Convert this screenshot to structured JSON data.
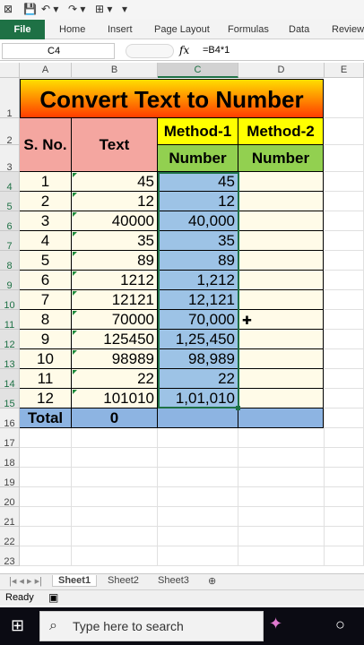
{
  "ribbon": {
    "file": "File",
    "tabs": [
      "Home",
      "Insert",
      "Page Layout",
      "Formulas",
      "Data",
      "Review"
    ]
  },
  "formula_bar": {
    "cell_ref": "C4",
    "fx": "fx",
    "formula": "=B4*1"
  },
  "columns": [
    "A",
    "B",
    "C",
    "D",
    "E"
  ],
  "rows": [
    "1",
    "2",
    "3",
    "4",
    "5",
    "6",
    "7",
    "8",
    "9",
    "10",
    "11",
    "12",
    "13",
    "14",
    "15",
    "16",
    "17",
    "18",
    "19",
    "20",
    "21",
    "22",
    "23"
  ],
  "sheet": {
    "title": "Convert Text to Number",
    "h_sno": "S. No.",
    "h_text": "Text",
    "h_method1": "Method-1",
    "h_method2": "Method-2",
    "h_number": "Number",
    "data": [
      {
        "sno": "1",
        "text": "45",
        "num": "45"
      },
      {
        "sno": "2",
        "text": "12",
        "num": "12"
      },
      {
        "sno": "3",
        "text": "40000",
        "num": "40,000"
      },
      {
        "sno": "4",
        "text": "35",
        "num": "35"
      },
      {
        "sno": "5",
        "text": "89",
        "num": "89"
      },
      {
        "sno": "6",
        "text": "1212",
        "num": "1,212"
      },
      {
        "sno": "7",
        "text": "12121",
        "num": "12,121"
      },
      {
        "sno": "8",
        "text": "70000",
        "num": "70,000"
      },
      {
        "sno": "9",
        "text": "125450",
        "num": "1,25,450"
      },
      {
        "sno": "10",
        "text": "98989",
        "num": "98,989"
      },
      {
        "sno": "11",
        "text": "22",
        "num": "22"
      },
      {
        "sno": "12",
        "text": "101010",
        "num": "1,01,010"
      }
    ],
    "total_label": "Total",
    "total_value": "0"
  },
  "sheet_tabs": [
    "Sheet1",
    "Sheet2",
    "Sheet3"
  ],
  "status": {
    "ready": "Ready"
  },
  "taskbar": {
    "search_placeholder": "Type here to search"
  },
  "colors": {
    "accent": "#1e7145",
    "header_pink": "#f4a6a0",
    "header_yellow": "#ffff00",
    "header_green": "#92d050",
    "method_blue": "#9dc3e6",
    "total_blue": "#8db4e2",
    "row_cream": "#fffbe8"
  }
}
